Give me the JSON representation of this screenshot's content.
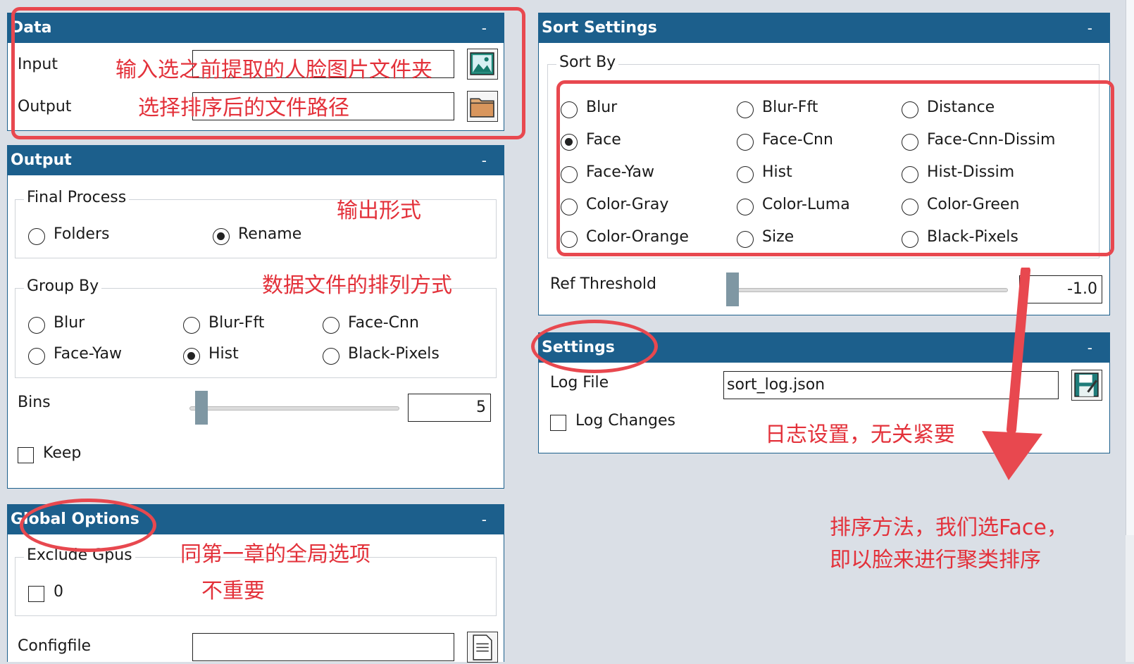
{
  "data_panel": {
    "title": "Data",
    "minimize": "-",
    "input_label": "Input",
    "output_label": "Output",
    "input_value": "",
    "output_value": ""
  },
  "output_panel": {
    "title": "Output",
    "minimize": "-",
    "final_process": {
      "title": "Final Process",
      "options": [
        "Folders",
        "Rename"
      ],
      "selected": "Rename"
    },
    "group_by": {
      "title": "Group By",
      "options": [
        "Blur",
        "Blur-Fft",
        "Face-Cnn",
        "Face-Yaw",
        "Hist",
        "Black-Pixels"
      ],
      "selected": "Hist"
    },
    "bins": {
      "label": "Bins",
      "value": "5",
      "slider_fraction": 0.05
    },
    "keep": {
      "label": "Keep",
      "checked": false
    }
  },
  "global_panel": {
    "title": "Global Options",
    "minimize": "-",
    "exclude_gpus": {
      "title": "Exclude Gpus",
      "option": "0",
      "checked": false
    },
    "configfile_label": "Configfile"
  },
  "sort_panel": {
    "title": "Sort Settings",
    "minimize": "-",
    "sort_by": {
      "title": "Sort By",
      "options": [
        "Blur",
        "Blur-Fft",
        "Distance",
        "Face",
        "Face-Cnn",
        "Face-Cnn-Dissim",
        "Face-Yaw",
        "Hist",
        "Hist-Dissim",
        "Color-Gray",
        "Color-Luma",
        "Color-Green",
        "Color-Orange",
        "Size",
        "Black-Pixels"
      ],
      "selected": "Face"
    },
    "ref_threshold": {
      "label": "Ref Threshold",
      "value": "-1.0",
      "slider_fraction": 0.0
    }
  },
  "settings_panel": {
    "title": "Settings",
    "minimize": "-",
    "log_file_label": "Log File",
    "log_file_value": "sort_log.json",
    "log_changes": {
      "label": "Log Changes",
      "checked": false
    }
  },
  "annotations": {
    "input_note": "输入选之前提取的人脸图片文件夹",
    "output_note": "选择排序后的文件路径",
    "format_note": "输出形式",
    "group_note": "数据文件的排列方式",
    "global_note_1": "同第一章的全局选项",
    "global_note_2": "不重要",
    "log_note": "日志设置，无关紧要",
    "sort_note_1": "排序方法，我们选Face，",
    "sort_note_2": "即以脸来进行聚类排序"
  },
  "colors": {
    "header": "#1c5f8c",
    "annotation": "#e3313a",
    "background": "#dadfe6"
  }
}
